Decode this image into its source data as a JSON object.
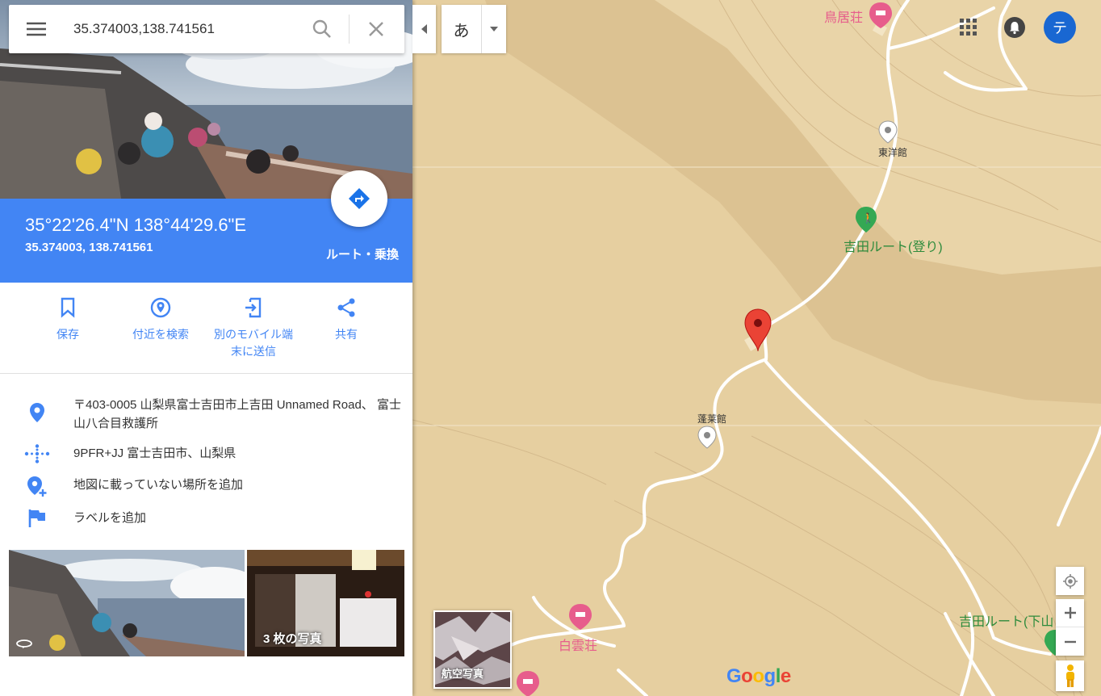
{
  "search": {
    "query": "35.374003,138.741561"
  },
  "ime": {
    "char": "あ"
  },
  "user": {
    "avatar_initial": "テ"
  },
  "place": {
    "dms": "35°22'26.4\"N 138°44'29.6\"E",
    "decimal": "35.374003, 138.741561",
    "route_label": "ルート・乗換"
  },
  "actions": [
    {
      "label": "保存"
    },
    {
      "label": "付近を検索"
    },
    {
      "label_line1": "別のモバイル端",
      "label_line2": "末に送信"
    },
    {
      "label": "共有"
    }
  ],
  "info": {
    "address": "〒403-0005 山梨県富士吉田市上吉田 Unnamed Road、 富士山八合目救護所",
    "plus_code": "9PFR+JJ 富士吉田市、山梨県",
    "add_missing": "地図に載っていない場所を追加",
    "add_label": "ラベルを追加"
  },
  "photos": {
    "count_label": "3 枚の写真"
  },
  "map": {
    "labels": {
      "toriiso": "鳥居荘",
      "toyokan": "東洋館",
      "yoshida_up": "吉田ルート(登り)",
      "horaikan": "蓬莱館",
      "hakuunso": "白雲荘",
      "yoshida_down": "吉田ルート(下山"
    },
    "aerial_label": "航空写真",
    "google_logo": "Google"
  },
  "colors": {
    "accent": "#4285f4",
    "terrain": "#e6cfa0",
    "terrain_light": "#d9be8f",
    "pin": "#ea4335"
  }
}
